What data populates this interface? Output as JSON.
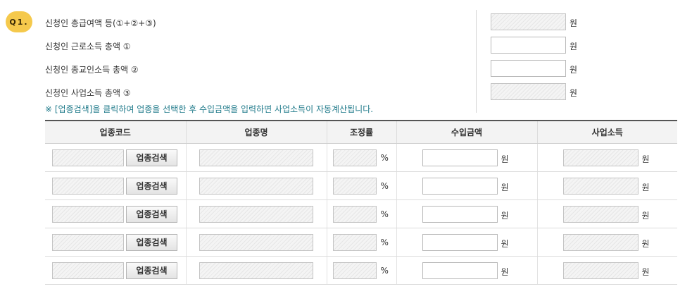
{
  "badge": "Q1.",
  "summary": {
    "rows": [
      {
        "label": "신청인 총급여액 등(①+②+③)",
        "unit": "원",
        "readonly": true
      },
      {
        "label": "신청인 근로소득 총액 ①",
        "unit": "원",
        "readonly": false
      },
      {
        "label": "신청인 종교인소득 총액 ②",
        "unit": "원",
        "readonly": false
      },
      {
        "label": "신청인 사업소득 총액 ③",
        "unit": "원",
        "readonly": true
      }
    ],
    "note": "※ [업종검색]을 클릭하여 업종을 선택한 후 수입금액을 입력하면 사업소득이 자동계산됩니다."
  },
  "table": {
    "headers": [
      "업종코드",
      "업종명",
      "조정률",
      "수입금액",
      "사업소득"
    ],
    "search_button_label": "업종검색",
    "rate_unit": "%",
    "amount_unit": "원",
    "income_unit": "원",
    "row_count": 5
  },
  "colors": {
    "badge": "#f5c94c",
    "note": "#1f7a8a",
    "header_bg": "#f3f3f3"
  }
}
